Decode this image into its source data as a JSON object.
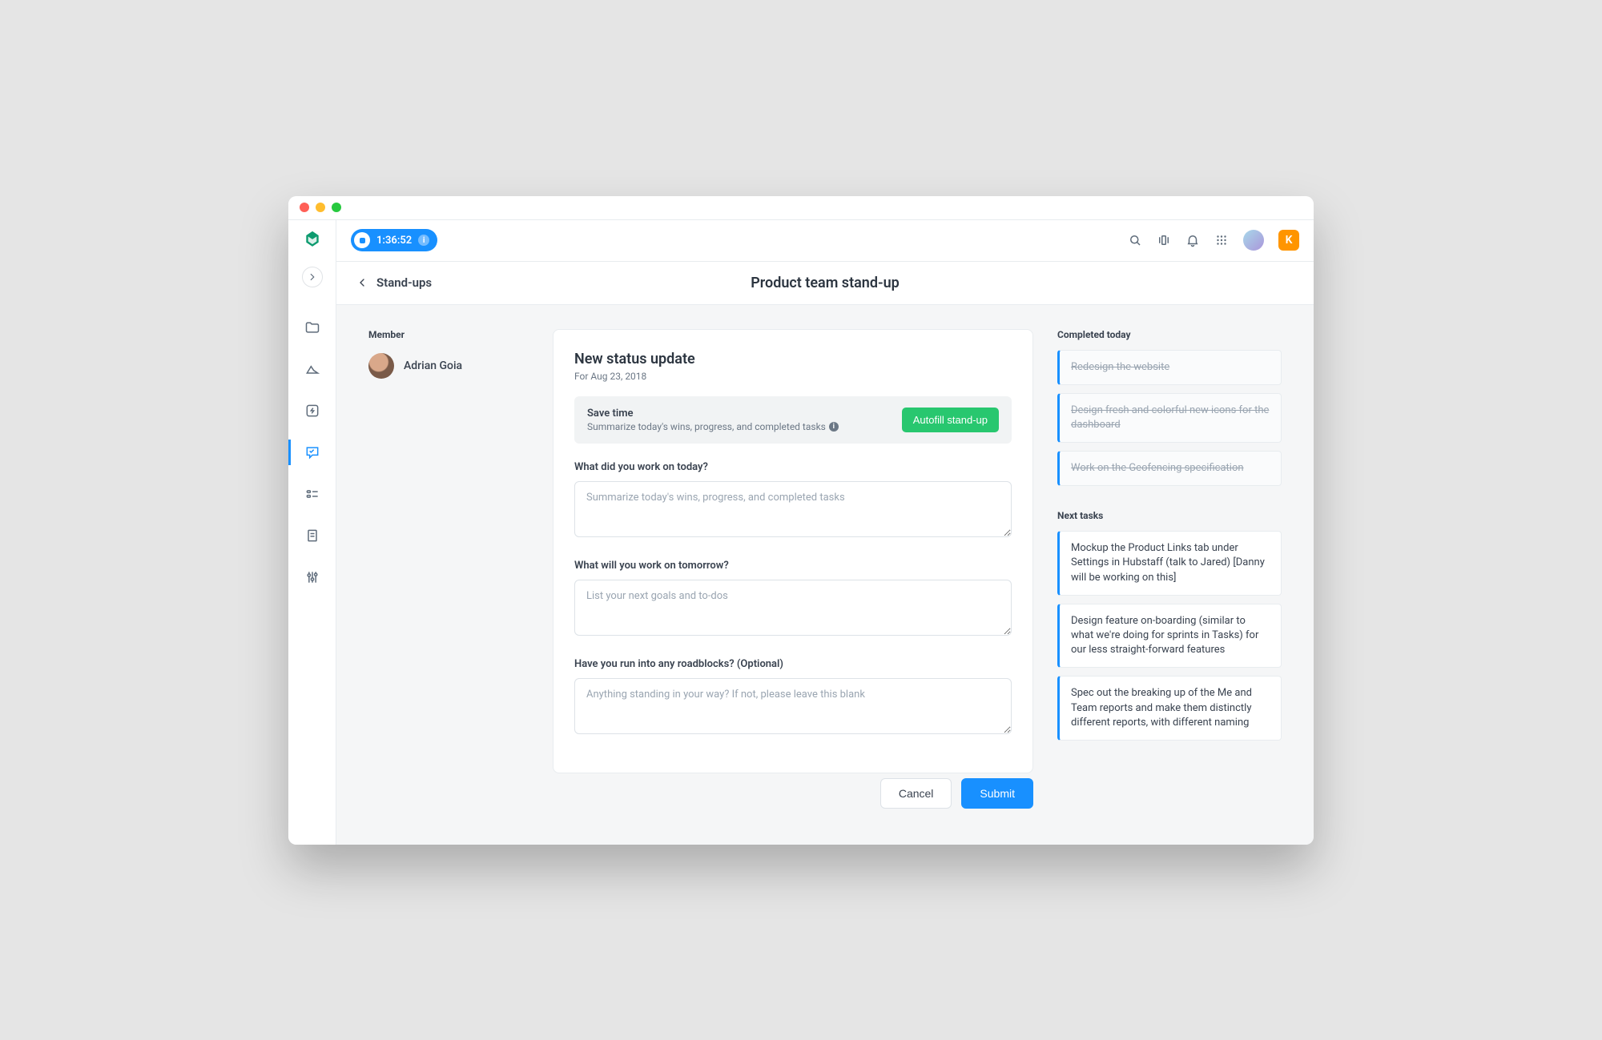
{
  "timer": {
    "value": "1:36:52"
  },
  "org_badge": "K",
  "breadcrumb": "Stand-ups",
  "page_title": "Product team stand-up",
  "member": {
    "label": "Member",
    "name": "Adrian Goia"
  },
  "form": {
    "title": "New status update",
    "subtitle": "For Aug 23, 2018",
    "tip_title": "Save time",
    "tip_desc": "Summarize today's wins, progress, and completed tasks",
    "autofill_label": "Autofill stand-up",
    "q1": {
      "label": "What did you work on today?",
      "placeholder": "Summarize today's wins, progress, and completed tasks"
    },
    "q2": {
      "label": "What will you work on tomorrow?",
      "placeholder": "List your next goals and to-dos"
    },
    "q3": {
      "label": "Have you run into any roadblocks? (Optional)",
      "placeholder": "Anything standing in your way? If not, please leave this blank"
    },
    "cancel": "Cancel",
    "submit": "Submit"
  },
  "sidebar_right": {
    "completed_label": "Completed today",
    "completed": [
      "Redesign the website",
      "Design fresh and colorful new icons for the dashboard",
      "Work on the Geofencing specification"
    ],
    "next_label": "Next tasks",
    "next": [
      "Mockup the Product Links tab under Settings in Hubstaff (talk to Jared) [Danny will be working on this]",
      "Design feature on-boarding (similar to what we're doing for sprints in Tasks) for our less straight-forward features",
      "Spec out the breaking up of the Me and Team reports and make them distinctly different reports, with different naming"
    ]
  }
}
